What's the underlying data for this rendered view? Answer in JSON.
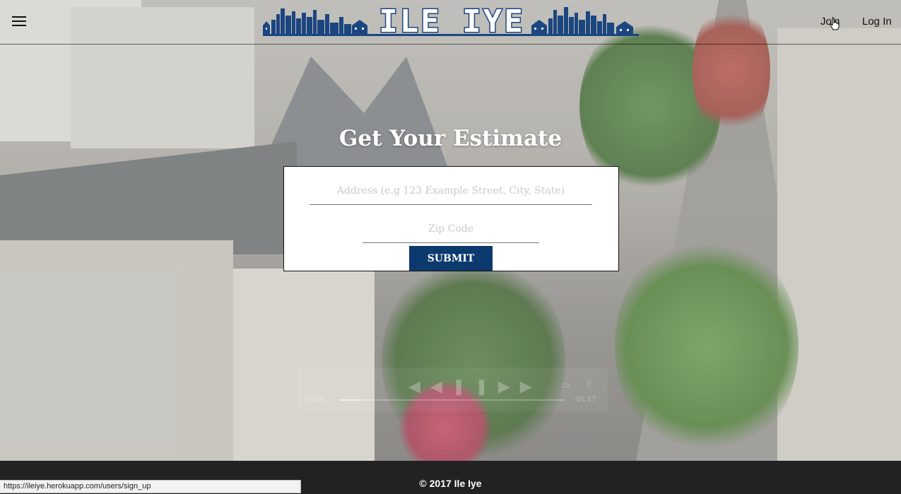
{
  "header": {
    "brand": "ILE IYE",
    "brand_color": "#1c4680",
    "nav": {
      "join_label": "Join",
      "login_label": "Log In"
    }
  },
  "hero": {
    "title": "Get Your Estimate",
    "form": {
      "address_placeholder": "Address (e.g 123 Example Street, City, State)",
      "address_value": "",
      "zip_placeholder": "Zip Code",
      "zip_value": "",
      "submit_label": "SUBMIT",
      "submit_color": "#0d3a6e"
    }
  },
  "video": {
    "elapsed": "00:08",
    "remaining": "-01:17",
    "progress": 0.1
  },
  "footer": {
    "copyright": "© 2017 Ile Iye"
  },
  "status_bar": {
    "url": "https://ileiye.herokuapp.com/users/sign_up"
  }
}
